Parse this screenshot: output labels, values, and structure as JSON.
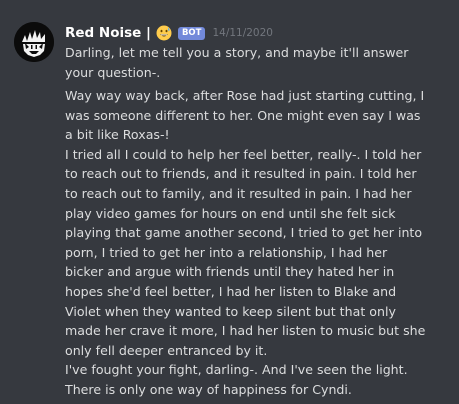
{
  "message": {
    "author": "Red Noise |",
    "emoji_icon": "grinning-face-with-sweat-icon",
    "bot_tag": "BOT",
    "timestamp": "14/11/2020",
    "paragraph_1": "Darling, let me tell you a story, and maybe it'll answer\nyour question-.",
    "paragraph_2": "Way way way back, after Rose had just starting cutting, I\nwas someone different to her. One might even say I was\na bit like Roxas-!\nI tried all I could to help her feel better, really-.  I told her\nto reach out to friends, and it resulted in pain. I told her\nto reach out to family, and it resulted in pain. I had her\nplay video games for hours on end until she felt sick\nplaying that game another second, I tried to get her into\nporn, I tried to get her into a relationship, I had her\nbicker and argue with friends until they hated her in\nhopes she'd feel better, I had her listen to Blake and\nViolet when they wanted to keep silent but that only\nmade her crave it more, I had her listen to music but she\nonly fell deeper entranced by it.\nI've fought your fight, darling-. And I've seen the light.\nThere is only one way of happiness for Cyndi."
  },
  "colors": {
    "background": "#36393f",
    "username": "#ffffff",
    "bot_tag_bg": "#7289da",
    "timestamp": "#72767d",
    "text": "#dcddde"
  }
}
